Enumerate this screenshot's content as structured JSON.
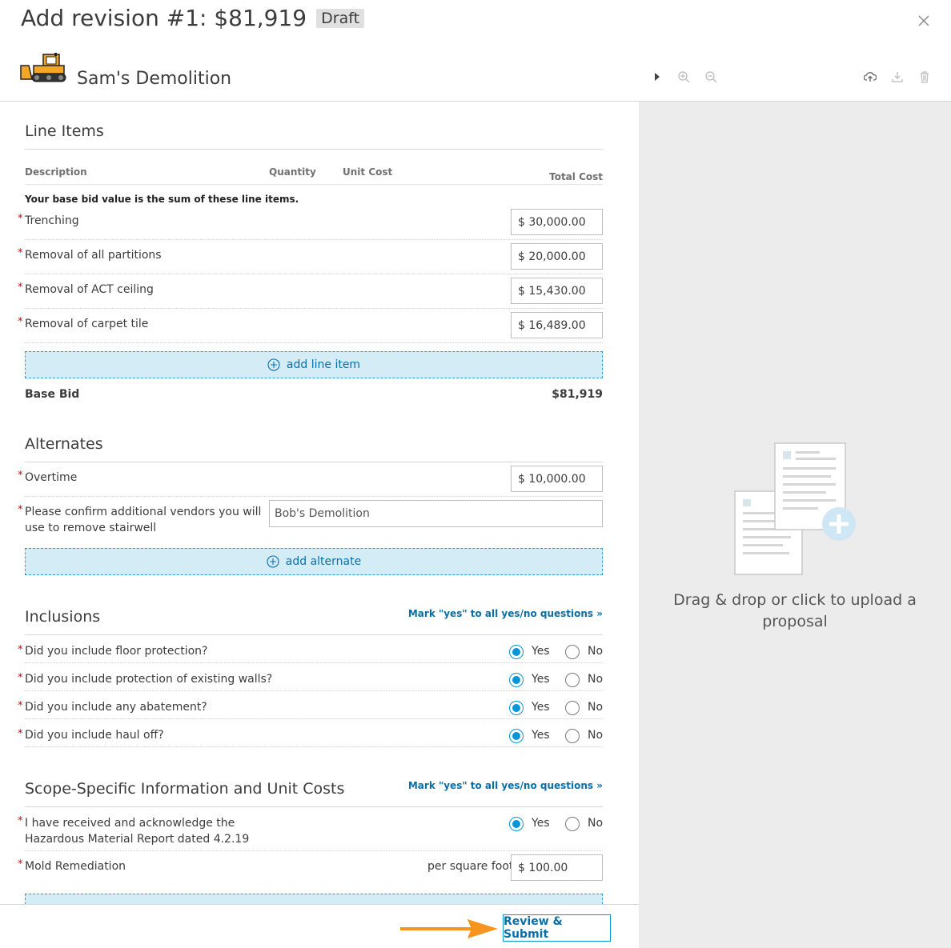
{
  "header": {
    "title": "Add revision #1: $81,919",
    "status_badge": "Draft",
    "company_name": "Sam's Demolition"
  },
  "line_items": {
    "section_title": "Line Items",
    "col_description": "Description",
    "col_quantity": "Quantity",
    "col_unit_cost": "Unit Cost",
    "col_total_cost": "Total Cost",
    "note": "Your base bid value is the sum of these line items.",
    "items": [
      {
        "label": "Trenching",
        "value": "$ 30,000.00"
      },
      {
        "label": "Removal of all partitions",
        "value": "$ 20,000.00"
      },
      {
        "label": "Removal of ACT ceiling",
        "value": "$ 15,430.00"
      },
      {
        "label": "Removal of carpet tile",
        "value": "$ 16,489.00"
      }
    ],
    "add_label": "add line item",
    "base_bid_label": "Base Bid",
    "base_bid_value": "$81,919"
  },
  "alternates": {
    "section_title": "Alternates",
    "overtime_label": "Overtime",
    "overtime_value": "$ 10,000.00",
    "vendors_label_1": "Please confirm additional vendors you will",
    "vendors_label_2": "use to remove stairwell",
    "vendors_value": "Bob's Demolition",
    "add_label": "add alternate"
  },
  "inclusions": {
    "section_title": "Inclusions",
    "mark_yes": "Mark \"yes\" to all yes/no questions »",
    "yes_label": "Yes",
    "no_label": "No",
    "questions": [
      "Did you include floor protection?",
      "Did you include protection of existing walls?",
      "Did you include any abatement?",
      "Did you include haul off?"
    ]
  },
  "scope": {
    "section_title": "Scope-Specific Information and Unit Costs",
    "mark_yes": "Mark \"yes\" to all yes/no questions »",
    "hazmat_label_1": "I have received and acknowledge the",
    "hazmat_label_2": "Hazardous Material Report dated 4.2.19",
    "yes_label": "Yes",
    "no_label": "No",
    "mold_label": "Mold Remediation",
    "mold_unit": "per square foot",
    "mold_value": "$ 100.00"
  },
  "footer": {
    "submit_label": "Review & Submit"
  },
  "upload": {
    "text_line1": "Drag & drop or click to upload a",
    "text_line2": "proposal"
  },
  "colors": {
    "accent": "#0696d7",
    "required": "#d0021b",
    "arrow": "#f7941d"
  }
}
